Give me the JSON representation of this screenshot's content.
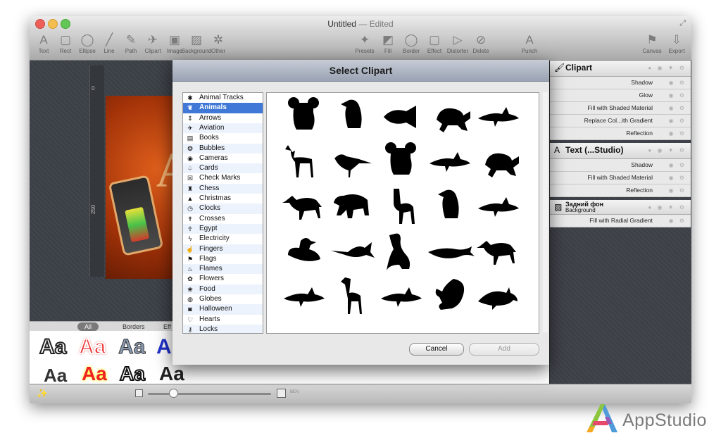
{
  "window": {
    "title": "Untitled",
    "title_suffix": "— Edited"
  },
  "toolbar": {
    "left": [
      {
        "label": "Text",
        "icon": "A"
      },
      {
        "label": "Rect",
        "icon": "▢"
      },
      {
        "label": "Ellipse",
        "icon": "◯"
      },
      {
        "label": "Line",
        "icon": "╱"
      },
      {
        "label": "Path",
        "icon": "✎"
      },
      {
        "label": "Clipart",
        "icon": "✈"
      },
      {
        "label": "Image",
        "icon": "▣"
      },
      {
        "label": "Background",
        "icon": "▨"
      },
      {
        "label": "Other",
        "icon": "✲"
      }
    ],
    "middle": [
      {
        "label": "Presets",
        "icon": "✦"
      },
      {
        "label": "Fill",
        "icon": "◩"
      },
      {
        "label": "Border",
        "icon": "◯"
      },
      {
        "label": "Effect",
        "icon": "▢"
      },
      {
        "label": "Distorter",
        "icon": "▷"
      },
      {
        "label": "Delete",
        "icon": "⊘"
      }
    ],
    "punch": {
      "label": "Punch",
      "icon": "A"
    },
    "right": [
      {
        "label": "Canvas",
        "icon": "⚑"
      },
      {
        "label": "Export",
        "icon": "⇩"
      }
    ]
  },
  "canvas": {
    "ruler_top": "0",
    "ruler_mid": "250"
  },
  "effects_bar": {
    "tabs": [
      "All",
      "Borders",
      "Eff"
    ]
  },
  "bottom_bar": {
    "size_label": "BEN"
  },
  "inspector": {
    "layers": [
      {
        "title": "Clipart",
        "icon": "🖌",
        "subs": [
          "Shadow",
          "Glow",
          "Fill with Shaded Material",
          "Replace Col...ith Gradient",
          "Reflection"
        ]
      },
      {
        "title": "Text (...Studio)",
        "icon": "A",
        "subs": [
          "Shadow",
          "Fill with Shaded Material",
          "Reflection"
        ]
      },
      {
        "title": "Задний фон",
        "subtitle": "Background",
        "icon": "▨",
        "subs": [
          "Fill with Radial Gradient"
        ]
      }
    ]
  },
  "dialog": {
    "title": "Select Clipart",
    "categories": [
      {
        "label": "Animal Tracks",
        "icon": "✱"
      },
      {
        "label": "Animals",
        "icon": "❦"
      },
      {
        "label": "Arrows",
        "icon": "⇕"
      },
      {
        "label": "Aviation",
        "icon": "✈"
      },
      {
        "label": "Books",
        "icon": "▤"
      },
      {
        "label": "Bubbles",
        "icon": "❂"
      },
      {
        "label": "Cameras",
        "icon": "◉"
      },
      {
        "label": "Cards",
        "icon": "♤"
      },
      {
        "label": "Check Marks",
        "icon": "☒"
      },
      {
        "label": "Chess",
        "icon": "♜"
      },
      {
        "label": "Christmas",
        "icon": "▲"
      },
      {
        "label": "Clocks",
        "icon": "◷"
      },
      {
        "label": "Crosses",
        "icon": "✝"
      },
      {
        "label": "Egypt",
        "icon": "☥"
      },
      {
        "label": "Electricity",
        "icon": "ϟ"
      },
      {
        "label": "Fingers",
        "icon": "☝"
      },
      {
        "label": "Flags",
        "icon": "⚑"
      },
      {
        "label": "Flames",
        "icon": "♨"
      },
      {
        "label": "Flowers",
        "icon": "✿"
      },
      {
        "label": "Food",
        "icon": "❀"
      },
      {
        "label": "Globes",
        "icon": "◍"
      },
      {
        "label": "Halloween",
        "icon": "◙"
      },
      {
        "label": "Hearts",
        "icon": "♡"
      },
      {
        "label": "Locks",
        "icon": "⚷"
      }
    ],
    "selected_category": "Animals",
    "clipart_icons": [
      "koala-icon",
      "penguin-icon",
      "fish-icon",
      "turtle-icon",
      "shark-icon",
      "gazelle-icon",
      "bird-icon",
      "koala-sitting-icon",
      "shark-icon",
      "tortoise-icon",
      "wolf-icon",
      "bear-icon",
      "llama-icon",
      "penguin-icon",
      "hammerhead-icon",
      "duck-icon",
      "marlin-icon",
      "goose-icon",
      "whale-icon",
      "coyote-icon",
      "shark-icon",
      "giraffe-icon",
      "shark-icon",
      "squirrel-icon",
      "dolphin-icon"
    ],
    "cancel_label": "Cancel",
    "add_label": "Add"
  },
  "watermark": {
    "text": "AppStudio"
  }
}
